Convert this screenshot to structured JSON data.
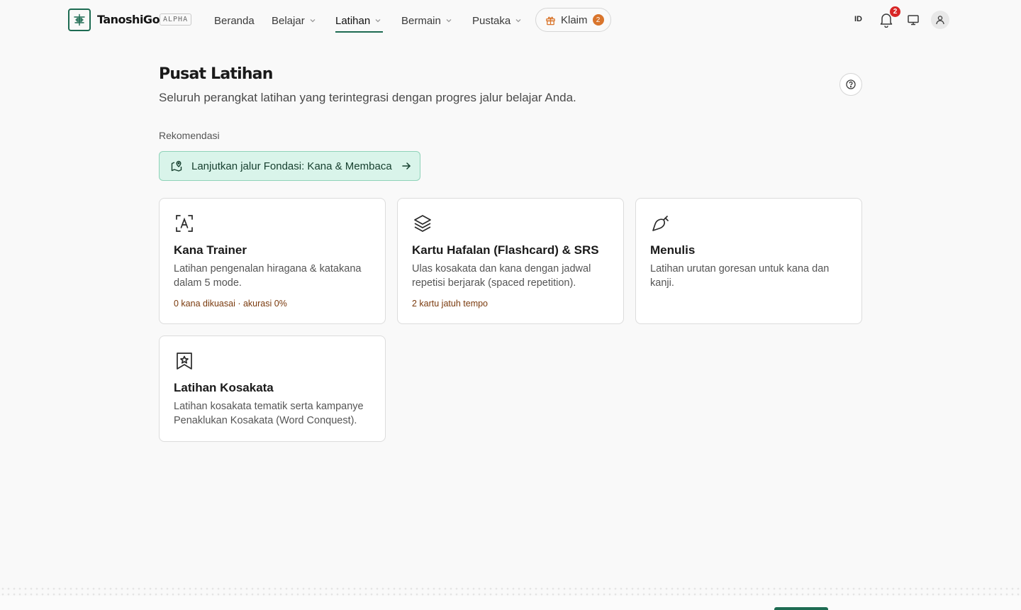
{
  "brand": {
    "name": "TanoshiGo",
    "badge": "ALPHA"
  },
  "nav": {
    "items": [
      {
        "label": "Beranda",
        "has_dropdown": false
      },
      {
        "label": "Belajar",
        "has_dropdown": true
      },
      {
        "label": "Latihan",
        "has_dropdown": true,
        "active": true
      },
      {
        "label": "Bermain",
        "has_dropdown": true
      },
      {
        "label": "Pustaka",
        "has_dropdown": true
      }
    ],
    "claim": {
      "label": "Klaim",
      "count": "2",
      "icon": "gift-icon"
    },
    "language": "ID",
    "notifications": {
      "count": "2",
      "icon": "bell-icon"
    },
    "display_icon": "monitor-icon",
    "profile_icon": "user-icon"
  },
  "page": {
    "title": "Pusat Latihan",
    "subtitle": "Seluruh perangkat latihan yang terintegrasi dengan progres jalur belajar Anda.",
    "help_icon": "help-circle-icon"
  },
  "recommendation": {
    "label": "Rekomendasi",
    "button": "Lanjutkan jalur Fondasi: Kana & Membaca",
    "icon": "map-pin-icon",
    "arrow_icon": "arrow-right-icon"
  },
  "cards": [
    {
      "icon": "kana-letter-icon",
      "title": "Kana Trainer",
      "desc": "Latihan pengenalan hiragana & katakana dalam 5 mode.",
      "meta": "0 kana dikuasai · akurasi 0%"
    },
    {
      "icon": "layers-icon",
      "title": "Kartu Hafalan (Flashcard) & SRS",
      "desc": "Ulas kosakata dan kana dengan jadwal repetisi berjarak (spaced repetition).",
      "meta": "2 kartu jatuh tempo"
    },
    {
      "icon": "brush-icon",
      "title": "Menulis",
      "desc": "Latihan urutan goresan untuk kana dan kanji.",
      "meta": ""
    },
    {
      "icon": "bookmark-star-icon",
      "title": "Latihan Kosakata",
      "desc": "Latihan kosakata tematik serta kampanye Penaklukan Kosakata (Word Conquest).",
      "meta": ""
    }
  ],
  "colors": {
    "accent": "#1d6b52",
    "recommend_bg": "#d9f4ea",
    "meta_text": "#7a3a0d",
    "badge_red": "#d82626",
    "claim_orange": "#d9752c"
  }
}
